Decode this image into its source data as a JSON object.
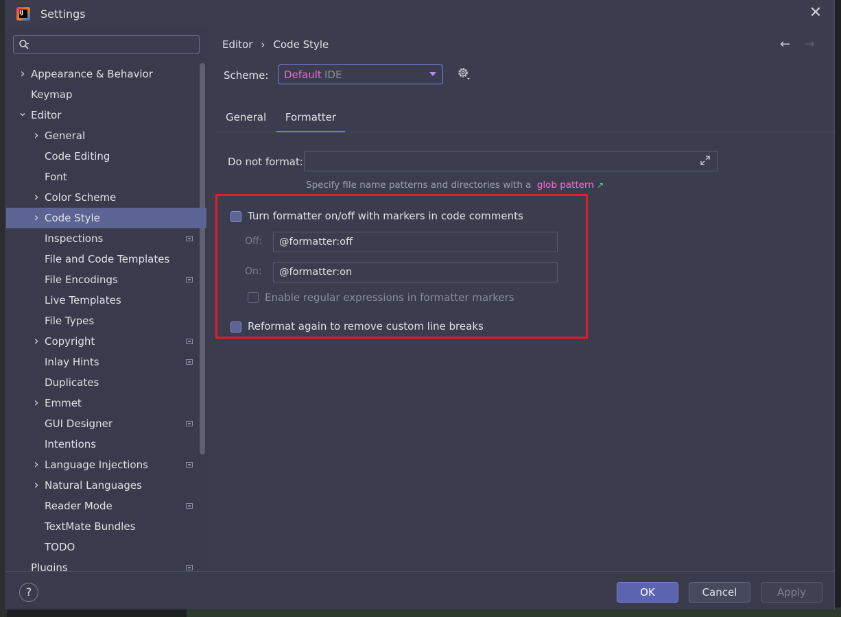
{
  "window": {
    "title": "Settings"
  },
  "search": {
    "placeholder": ""
  },
  "sidebar": {
    "items": [
      {
        "label": "Appearance & Behavior",
        "level": 0,
        "chevron": "right",
        "badge": false
      },
      {
        "label": "Keymap",
        "level": 0,
        "chevron": "none",
        "badge": false
      },
      {
        "label": "Editor",
        "level": 0,
        "chevron": "down",
        "badge": false
      },
      {
        "label": "General",
        "level": 1,
        "chevron": "right",
        "badge": false
      },
      {
        "label": "Code Editing",
        "level": 1,
        "chevron": "none",
        "badge": false
      },
      {
        "label": "Font",
        "level": 1,
        "chevron": "none",
        "badge": false
      },
      {
        "label": "Color Scheme",
        "level": 1,
        "chevron": "right",
        "badge": false
      },
      {
        "label": "Code Style",
        "level": 1,
        "chevron": "right",
        "badge": false,
        "selected": true
      },
      {
        "label": "Inspections",
        "level": 1,
        "chevron": "none",
        "badge": true
      },
      {
        "label": "File and Code Templates",
        "level": 1,
        "chevron": "none",
        "badge": false
      },
      {
        "label": "File Encodings",
        "level": 1,
        "chevron": "none",
        "badge": true
      },
      {
        "label": "Live Templates",
        "level": 1,
        "chevron": "none",
        "badge": false
      },
      {
        "label": "File Types",
        "level": 1,
        "chevron": "none",
        "badge": false
      },
      {
        "label": "Copyright",
        "level": 1,
        "chevron": "right",
        "badge": true
      },
      {
        "label": "Inlay Hints",
        "level": 1,
        "chevron": "none",
        "badge": true
      },
      {
        "label": "Duplicates",
        "level": 1,
        "chevron": "none",
        "badge": false
      },
      {
        "label": "Emmet",
        "level": 1,
        "chevron": "right",
        "badge": false
      },
      {
        "label": "GUI Designer",
        "level": 1,
        "chevron": "none",
        "badge": true
      },
      {
        "label": "Intentions",
        "level": 1,
        "chevron": "none",
        "badge": false
      },
      {
        "label": "Language Injections",
        "level": 1,
        "chevron": "right",
        "badge": true
      },
      {
        "label": "Natural Languages",
        "level": 1,
        "chevron": "right",
        "badge": false
      },
      {
        "label": "Reader Mode",
        "level": 1,
        "chevron": "none",
        "badge": true
      },
      {
        "label": "TextMate Bundles",
        "level": 1,
        "chevron": "none",
        "badge": false
      },
      {
        "label": "TODO",
        "level": 1,
        "chevron": "none",
        "badge": false
      },
      {
        "label": "Plugins",
        "level": 0,
        "chevron": "none",
        "badge": true
      }
    ]
  },
  "breadcrumb": {
    "parent": "Editor",
    "separator": "›",
    "current": "Code Style"
  },
  "scheme": {
    "label": "Scheme:",
    "name": "Default",
    "kind": "IDE"
  },
  "tabs": [
    {
      "label": "General",
      "active": false
    },
    {
      "label": "Formatter",
      "active": true
    }
  ],
  "formatter": {
    "do_not_format_label": "Do not format:",
    "do_not_format_value": "",
    "hint_text": "Specify file name patterns and directories with a",
    "hint_link": "glob pattern",
    "hint_link_arrow": "↗",
    "markers_checkbox": {
      "label": "Turn formatter on/off with markers in code comments",
      "checked": false
    },
    "off_label": "Off:",
    "off_value": "@formatter:off",
    "on_label": "On:",
    "on_value": "@formatter:on",
    "regex_checkbox": {
      "label": "Enable regular expressions in formatter markers",
      "checked": false,
      "enabled": false
    },
    "reformat_checkbox": {
      "label": "Reformat again to remove custom line breaks",
      "checked": false
    }
  },
  "footer": {
    "help_label": "?",
    "ok_label": "OK",
    "cancel_label": "Cancel",
    "apply_label": "Apply"
  },
  "colors": {
    "accent": "#5c64b0",
    "selection": "#5c6494",
    "link": "#ff6ad5",
    "highlight_box": "#e8192c"
  }
}
